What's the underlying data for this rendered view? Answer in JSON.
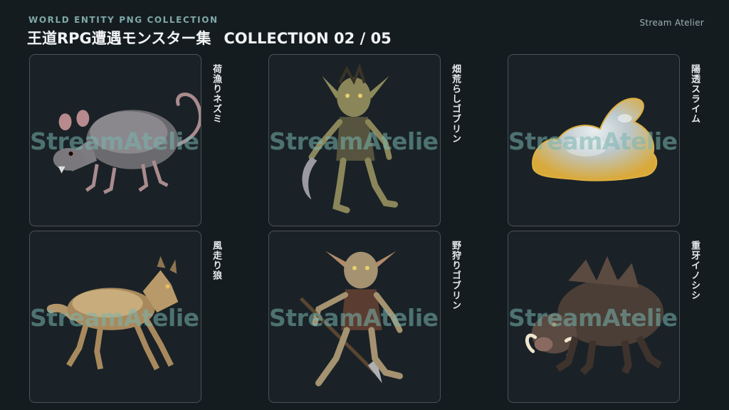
{
  "header": {
    "kicker": "WORLD ENTITY PNG COLLECTION",
    "title": "王道RPG遭遇モンスター集",
    "collection": "COLLECTION 02 / 05",
    "brand": "Stream Atelier"
  },
  "watermark": "StreamAtelier",
  "monsters": [
    {
      "name": "荷漁りネズミ",
      "icon": "rat-illustration"
    },
    {
      "name": "畑荒らしゴブリン",
      "icon": "goblin-sickle-illustration"
    },
    {
      "name": "陽透スライム",
      "icon": "slime-illustration"
    },
    {
      "name": "風走り狼",
      "icon": "wolf-illustration"
    },
    {
      "name": "野狩りゴブリン",
      "icon": "goblin-spear-illustration"
    },
    {
      "name": "重牙イノシシ",
      "icon": "boar-illustration"
    }
  ]
}
